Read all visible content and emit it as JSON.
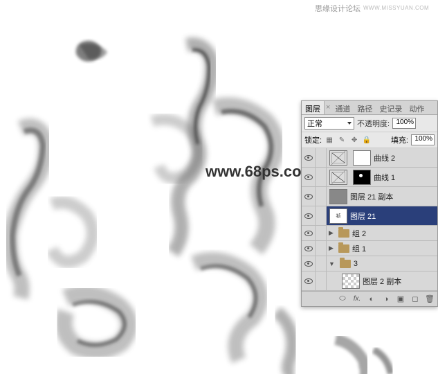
{
  "header": {
    "title": "思缘设计论坛",
    "subtitle": "WWW.MISSYUAN.COM"
  },
  "watermark": "www.68ps.com",
  "panel": {
    "tabs": {
      "layers": "图层",
      "channels": "通道",
      "paths": "路径",
      "history": "史记录",
      "actions": "动作"
    },
    "blend_mode": "正常",
    "opacity_label": "不透明度:",
    "opacity_value": "100%",
    "lock_label": "锁定:",
    "fill_label": "填充:",
    "fill_value": "100%",
    "layers": [
      {
        "name": "曲线 2",
        "type": "curves"
      },
      {
        "name": "曲线 1",
        "type": "curves-black"
      },
      {
        "name": "图层 21 副本",
        "type": "gray"
      },
      {
        "name": "图层 21",
        "type": "ink",
        "selected": true
      },
      {
        "name": "组 2",
        "type": "folder"
      },
      {
        "name": "组 1",
        "type": "folder"
      },
      {
        "name": "3",
        "type": "folder-open"
      },
      {
        "name": "图层 2 副本",
        "type": "checker",
        "nested": true
      }
    ]
  }
}
